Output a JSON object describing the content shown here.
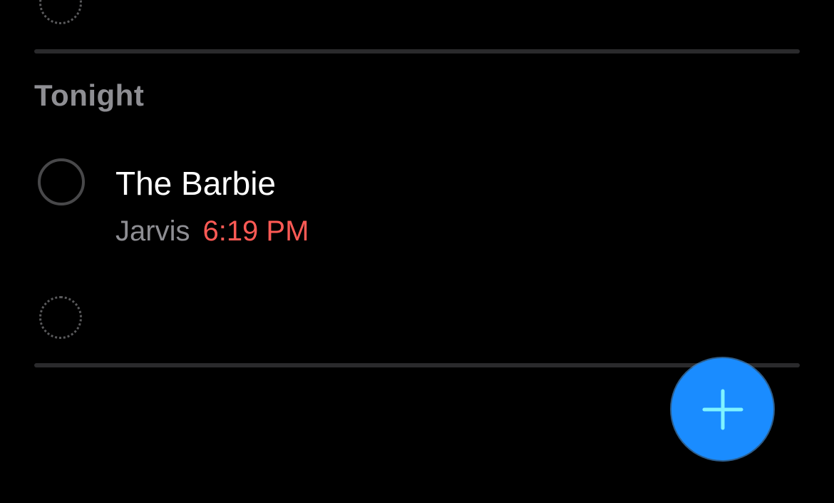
{
  "section": {
    "title": "Tonight"
  },
  "task": {
    "title": "The Barbie",
    "list_name": "Jarvis",
    "due_time": "6:19 PM"
  },
  "fab": {
    "icon": "plus-icon",
    "color": "#1a8cff"
  },
  "colors": {
    "background": "#000000",
    "due_time": "#ff5a55",
    "secondary_text": "#8e8e93"
  }
}
